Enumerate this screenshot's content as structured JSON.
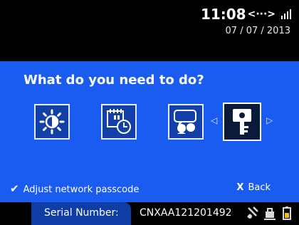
{
  "status": {
    "time": "11:08",
    "signal_glyph": "<···>",
    "date": "07 / 07 / 2013"
  },
  "menu": {
    "question": "What do you need to do?",
    "items": [
      {
        "icon": "brightness-icon"
      },
      {
        "icon": "calendar-clock-icon"
      },
      {
        "icon": "help-speech-icon"
      },
      {
        "icon": "key-icon",
        "selected": true
      }
    ]
  },
  "actions": {
    "confirm_label": "Adjust network passcode",
    "back_x": "X",
    "back_label": "Back"
  },
  "footer": {
    "serial_label": "Serial Number:",
    "serial_value": "CNXAA121201492",
    "status_icons": [
      "service-tool-icon",
      "maintenance-icon",
      "battery-warning-icon"
    ]
  },
  "colors": {
    "panel": "#1b5cf0",
    "background": "#000000"
  }
}
